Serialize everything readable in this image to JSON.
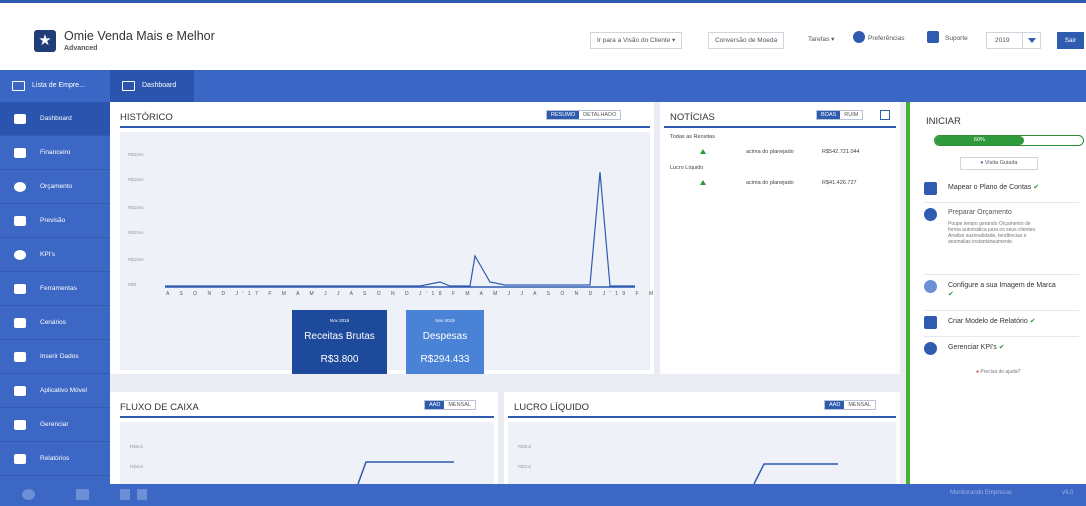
{
  "header": {
    "app_title": "Omie Venda Mais e Melhor",
    "app_subtitle": "Advanced",
    "btn_visao_cliente": "Ir para a Visão do Cliente ▾",
    "btn_conversao": "Conversão de Moeda",
    "tarefas": "Tarefas ▾",
    "preferencias": "Preferências",
    "suporte": "Suporte",
    "year": "2019",
    "sair": "Sair"
  },
  "tabs": [
    {
      "label": "Lista de Empre..."
    },
    {
      "label": "Dashboard"
    }
  ],
  "sidebar": {
    "items": [
      {
        "label": "Dashboard"
      },
      {
        "label": "Financeiro"
      },
      {
        "label": "Orçamento"
      },
      {
        "label": "Previsão"
      },
      {
        "label": "KPI's"
      },
      {
        "label": "Ferramentas"
      },
      {
        "label": "Cenários"
      },
      {
        "label": "Inserir Dados"
      },
      {
        "label": "Aplicativo Móvel"
      },
      {
        "label": "Gerenciar"
      },
      {
        "label": "Relatórios"
      }
    ]
  },
  "historico": {
    "title": "HISTÓRICO",
    "toggle_on": "RESUMO",
    "toggle_off": "DETALHADO",
    "y_ticks": [
      "R$20mi",
      "R$15mi",
      "R$10mi",
      "R$20mi",
      "R$10mi",
      "R$0"
    ],
    "months": "A S O N D J'17 F M A M J J A S O N D J'18 F M A M J J A S O N D J'19 F M A M J J A S O N",
    "card1": {
      "month": "Nov 2019",
      "label": "Receitas Brutas",
      "value": "R$3.800"
    },
    "card2": {
      "month": "Nov 2019",
      "label": "Despesas",
      "value": "R$294.433"
    }
  },
  "noticias": {
    "title": "NOTÍCIAS",
    "toggle_on": "BOAS",
    "toggle_off": "RUIM",
    "section1": "Todas as Receitas",
    "row1_text": "acima do planejado",
    "row1_value": "R$542.721.044",
    "section2": "Lucro Líquido",
    "row2_text": "acima do planejado",
    "row2_value": "R$41.426.727"
  },
  "fluxo": {
    "title": "FLUXO DE CAIXA",
    "toggle_on": "AAD",
    "toggle_off": "MENSAL",
    "y_ticks": [
      "R$5mi",
      "R$4mi"
    ]
  },
  "lucro": {
    "title": "LUCRO LÍQUIDO",
    "toggle_on": "AAD",
    "toggle_off": "MENSAL",
    "y_ticks": [
      "R$3mi",
      "R$1mi"
    ]
  },
  "iniciar": {
    "title": "INICIAR",
    "progress": 0.6,
    "progress_label": "60%",
    "visita": "Visita Guiada",
    "item1": "Mapear o Plano de Contas",
    "item2_title": "Preparar Orçamento",
    "item2_desc": "Poupe tempo gerando Orçamento de forma automática para os seus clientes. Analise sazonalidade, tendências e anomalias instantaneamente.",
    "item3": "Configure a sua Imagem de Marca",
    "item4": "Criar Modelo de Relatório",
    "item5": "Gerenciar KPI's",
    "help": "Precisa de ajuda?"
  },
  "footer": {
    "right_text": "Monitorando Empresas",
    "right_text2": "v9.0"
  },
  "colors": {
    "primary": "#2f5bb0",
    "sidebar": "#3c67c4",
    "green": "#44b034",
    "card1": "#1e4a9c",
    "card2": "#4a82d6"
  }
}
